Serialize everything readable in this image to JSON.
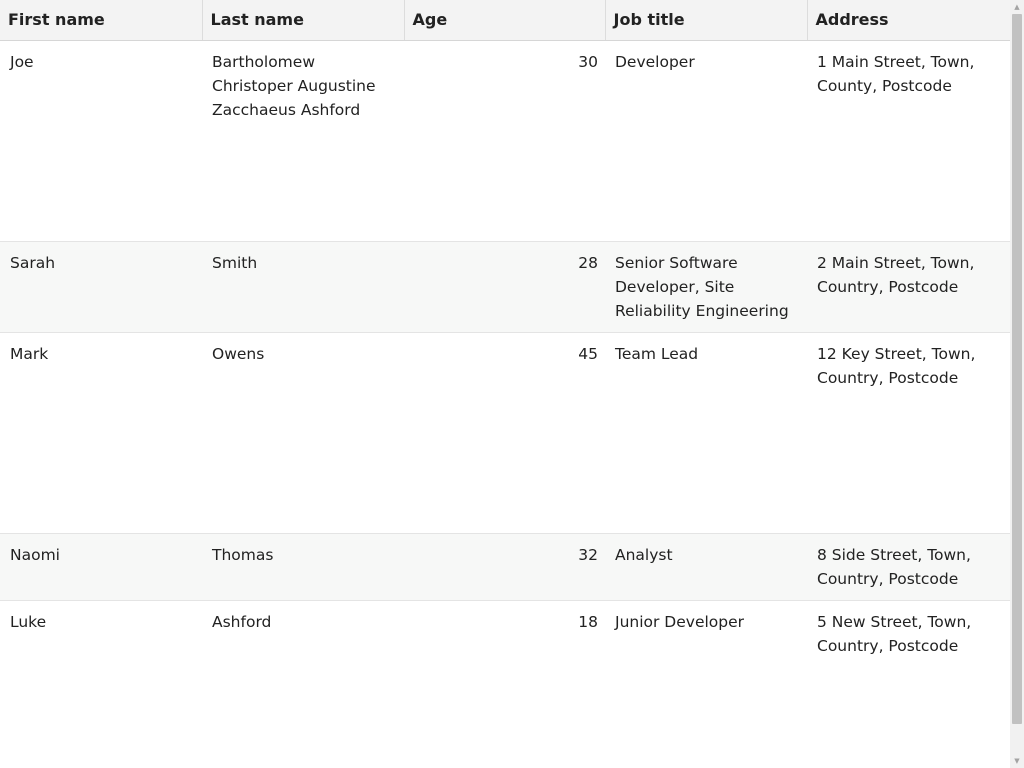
{
  "table": {
    "headers": [
      "First name",
      "Last name",
      "Age",
      "Job title",
      "Address"
    ],
    "rows": [
      {
        "first_name": "Joe",
        "last_name": "Bartholomew Christoper Augustine Zacchaeus Ashford",
        "age": "30",
        "job_title": "Developer",
        "address": "1 Main Street, Town, County, Postcode"
      },
      {
        "first_name": "Sarah",
        "last_name": "Smith",
        "age": "28",
        "job_title": "Senior Software Developer, Site Reliability Engineering",
        "address": "2 Main Street, Town, Country, Postcode"
      },
      {
        "first_name": "Mark",
        "last_name": "Owens",
        "age": "45",
        "job_title": "Team Lead",
        "address": "12 Key Street, Town, Country, Postcode"
      },
      {
        "first_name": "Naomi",
        "last_name": "Thomas",
        "age": "32",
        "job_title": "Analyst",
        "address": "8 Side Street, Town, Country, Postcode"
      },
      {
        "first_name": "Luke",
        "last_name": "Ashford",
        "age": "18",
        "job_title": "Junior Developer",
        "address": "5 New Street, Town, Country, Postcode"
      }
    ]
  },
  "scrollbar": {
    "up_icon": "scroll-up-arrow-icon",
    "down_icon": "scroll-down-arrow-icon"
  },
  "colors": {
    "header_background": "#f3f3f3",
    "striped_row_background": "#f7f8f7",
    "text": "#222222",
    "scrollbar_thumb": "#c1c1c1"
  }
}
